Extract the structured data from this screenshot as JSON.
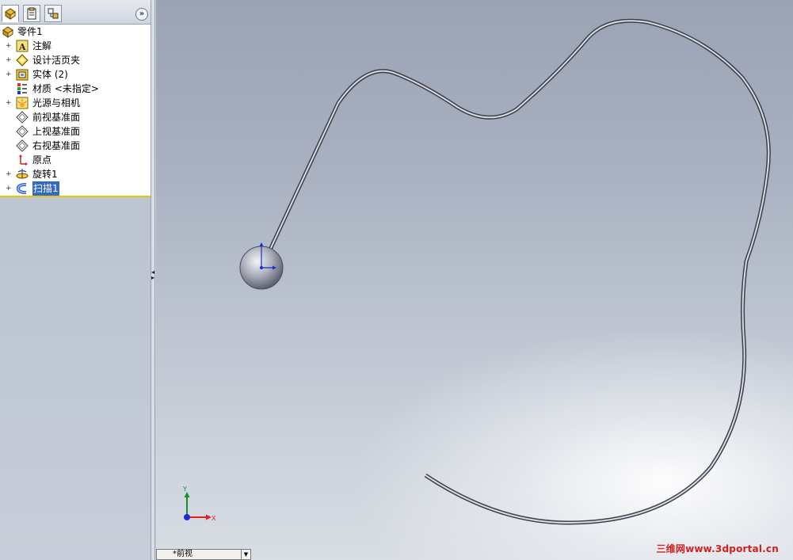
{
  "feature_tree": {
    "root_label": "零件1",
    "items": [
      {
        "label": "注解",
        "icon": "annotation-icon",
        "expandable": true
      },
      {
        "label": "设计活页夹",
        "icon": "design-binder-icon",
        "expandable": true
      },
      {
        "label": "实体 (2)",
        "icon": "solid-bodies-icon",
        "expandable": true
      },
      {
        "label": "材质 <未指定>",
        "icon": "material-icon",
        "expandable": false
      },
      {
        "label": "光源与相机",
        "icon": "lights-cameras-icon",
        "expandable": true
      },
      {
        "label": "前视基准面",
        "icon": "plane-icon",
        "expandable": false
      },
      {
        "label": "上视基准面",
        "icon": "plane-icon",
        "expandable": false
      },
      {
        "label": "右视基准面",
        "icon": "plane-icon",
        "expandable": false
      },
      {
        "label": "原点",
        "icon": "origin-icon",
        "expandable": false
      },
      {
        "label": "旋转1",
        "icon": "revolve-icon",
        "expandable": true
      },
      {
        "label": "扫描1",
        "icon": "sweep-icon",
        "expandable": true,
        "selected": true
      }
    ],
    "expand_glyph": "+"
  },
  "panel_tabs": [
    "feature-manager-tab",
    "property-manager-tab",
    "configuration-manager-tab"
  ],
  "viewport": {
    "view_tab_label": "*前视",
    "triad": {
      "x_label": "X",
      "y_label": "Y"
    }
  },
  "watermark": "三维网www.3dportal.cn",
  "colors": {
    "selection": "#3169c6",
    "tree_divider": "#e6c800",
    "watermark": "#d51f1f"
  }
}
